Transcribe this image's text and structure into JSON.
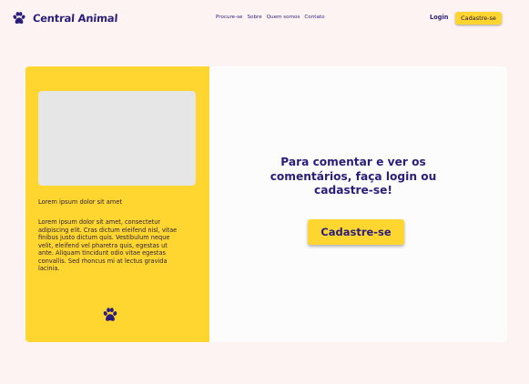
{
  "header": {
    "brand": "Central Animal",
    "brand_icon": "paw-icon",
    "nav": [
      "Procure-se",
      "Sobre",
      "Quem somos",
      "Contato"
    ],
    "login_label": "Login",
    "signup_label": "Cadastre-se"
  },
  "post": {
    "image_icon": "image-placeholder",
    "title": "Lorem ipsum dolor sit amet",
    "body": "Lorem ipsum dolor sit amet, consectetur adipiscing elit. Cras dictum eleifend nisl, vitae finibus justo dictum quis. Vestibulum neque velit, eleifend vel pharetra quis, egestas ut ante. Aliquam tincidunt odio vitae egestas convallis. Sed rhoncus mi at lectus gravida lacinia.",
    "footer_icon": "paw-icon"
  },
  "comments": {
    "prompt": "Para comentar e ver os comentários, faça login ou cadastre-se!",
    "signup_label": "Cadastre-se"
  },
  "colors": {
    "accent": "#ffd530",
    "brand_text": "#2a1e7a",
    "page_bg": "#fdf3f3"
  }
}
